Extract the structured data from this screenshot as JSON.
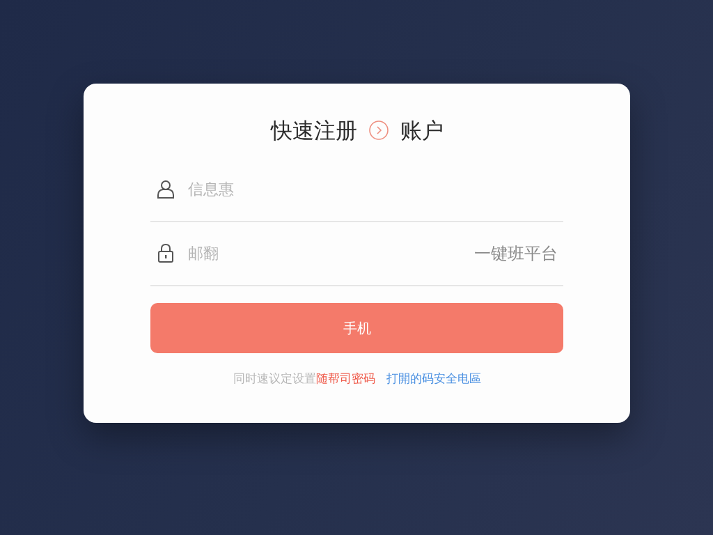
{
  "title": {
    "left": "快速注册",
    "right": "账户"
  },
  "fields": [
    {
      "kind": "user",
      "placeholder": "信息惠"
    },
    {
      "kind": "lock",
      "placeholder": "邮翻",
      "suffix": "一键班平台"
    }
  ],
  "submit": "手机",
  "footer": {
    "text": "同时速议定设置",
    "highlight": "随帮司密码",
    "link": "打開的码安全电區"
  }
}
